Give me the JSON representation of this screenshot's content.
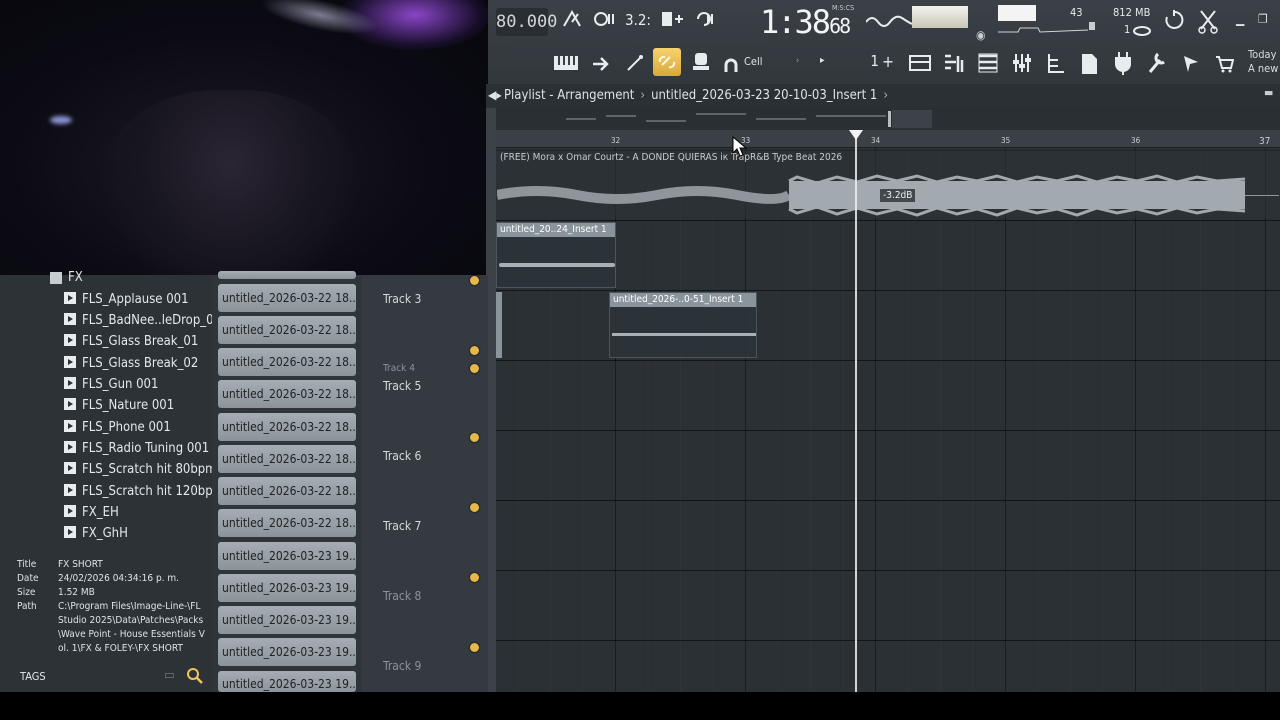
{
  "toolbar": {
    "tempo": "80.000",
    "time_main": "1:38",
    "time_cs": "68",
    "time_label": "M:S:CS",
    "cpu": "43",
    "memory": "812 MB",
    "polyphony": "1",
    "snap_mode": "Cell",
    "pattern_number": "1",
    "pattern_plus": "+",
    "hint_time": "Today",
    "hint_text": "A new"
  },
  "playlist": {
    "breadcrumb_root": "Playlist - Arrangement",
    "breadcrumb_sep": "›",
    "breadcrumb_item": "untitled_2026-03-23 20-10-03_Insert 1",
    "breadcrumb_end": "›",
    "ruler": [
      "32",
      "33",
      "34",
      "35",
      "36",
      "37"
    ],
    "clips": [
      {
        "name": "(FREE) Mora x Omar Courtz - A DONDE QUIERAS ік TrapR&B Type Beat 2026"
      },
      {
        "name": "untitled_20..24_Insert 1"
      },
      {
        "name": "untitled_2026-..0-51_Insert 1"
      }
    ],
    "volume_label": "-3.2dB"
  },
  "tracks": [
    {
      "label": "Track 3",
      "dim": false
    },
    {
      "label": "Track 4",
      "dim": true
    },
    {
      "label": "Track 5",
      "dim": false
    },
    {
      "label": "Track 6",
      "dim": false
    },
    {
      "label": "Track 7",
      "dim": false
    },
    {
      "label": "Track 8",
      "dim": true
    },
    {
      "label": "Track 9",
      "dim": true
    }
  ],
  "browser": {
    "folder": "FX",
    "items": [
      "FLS_Applause 001",
      "FLS_BadNee..leDrop_02",
      "FLS_Glass Break_01",
      "FLS_Glass Break_02",
      "FLS_Gun 001",
      "FLS_Nature 001",
      "FLS_Phone 001",
      "FLS_Radio Tuning 001",
      "FLS_Scratch hit 80bpm",
      "FLS_Scratch hit 120bpm",
      "FX_EH",
      "FX_GhH"
    ],
    "info": {
      "title_key": "Title",
      "title_val": "FX SHORT",
      "date_key": "Date",
      "date_val": "24/02/2026 04:34:16 p. m.",
      "size_key": "Size",
      "size_val": "1.52 MB",
      "path_key": "Path",
      "path_val": "C:\\Program Files\\Image-Line-\\FL Studio 2025\\Data\\Patches\\Packs\\Wave Point - House Essentials Vol. 1\\FX & FOLEY-\\FX SHORT"
    },
    "tags_label": "TAGS"
  },
  "picker": {
    "items": [
      "untitled_2026-03-22 18...",
      "untitled_2026-03-22 18...",
      "untitled_2026-03-22 18...",
      "untitled_2026-03-22 18...",
      "untitled_2026-03-22 18...",
      "untitled_2026-03-22 18...",
      "untitled_2026-03-22 18...",
      "untitled_2026-03-22 18...",
      "untitled_2026-03-23 19...",
      "untitled_2026-03-23 19...",
      "untitled_2026-03-23 19...",
      "untitled_2026-03-23 19...",
      "untitled_2026-03-23 19..."
    ]
  },
  "colors": {
    "accent_link": "#f0c55a",
    "track_dot": "#e6b84a",
    "clip_header": "#8a949b"
  }
}
